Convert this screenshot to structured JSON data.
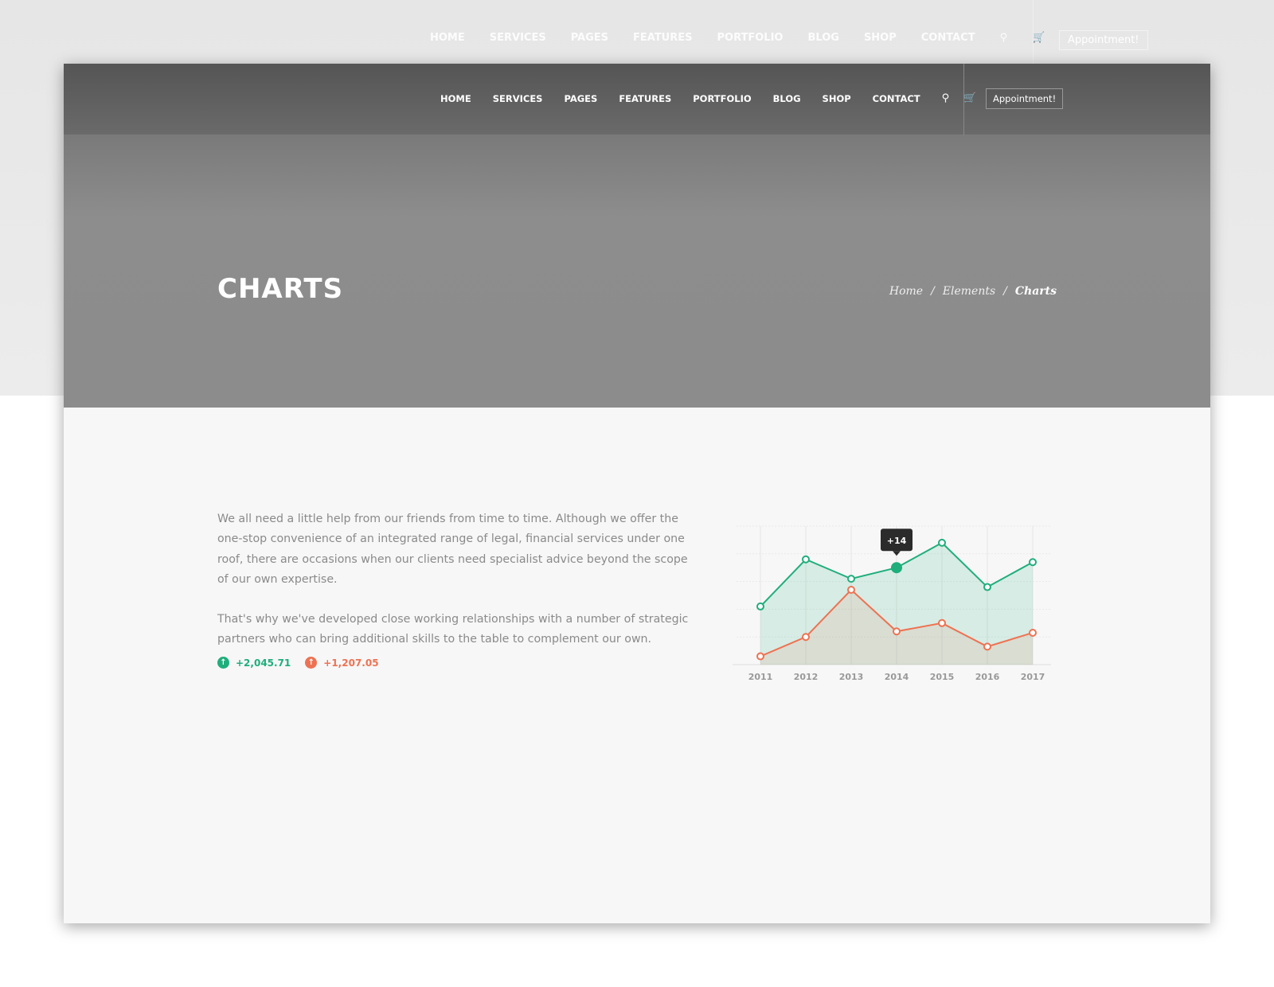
{
  "nav": {
    "items": [
      "HOME",
      "SERVICES",
      "PAGES",
      "FEATURES",
      "PORTFOLIO",
      "BLOG",
      "SHOP",
      "CONTACT"
    ],
    "search_icon": "search-icon",
    "cart_icon": "cart-icon",
    "appointment": "Appointment!"
  },
  "hero": {
    "title": "CHARTS",
    "breadcrumb": [
      "Home",
      "Elements",
      "Charts"
    ]
  },
  "content": {
    "paragraphs": [
      "We all need a little help from our friends from time to time. Although we offer the one-stop convenience of an integrated range of legal, financial services under one roof, there are occasions when our clients need specialist advice beyond the scope of our own expertise.",
      "That's why we've developed close working relationships with a number of strategic partners who can bring additional skills to the table to complement our own."
    ],
    "stats": [
      {
        "value": "+2,045.71",
        "color": "#1fae7c"
      },
      {
        "value": "+1,207.05",
        "color": "#ee7252"
      }
    ]
  },
  "chart_data": {
    "type": "area",
    "categories": [
      "2011",
      "2012",
      "2013",
      "2014",
      "2015",
      "2016",
      "2017"
    ],
    "ylim": [
      0,
      50
    ],
    "grid": true,
    "series": [
      {
        "values": [
          21,
          38,
          31,
          35,
          44,
          28,
          37
        ],
        "color": "#1fae7c"
      },
      {
        "values": [
          3,
          10,
          27,
          12,
          15,
          6.5,
          11.5
        ],
        "color": "#ee7252"
      }
    ],
    "tooltip": {
      "category": "2014",
      "text": "+14"
    }
  }
}
